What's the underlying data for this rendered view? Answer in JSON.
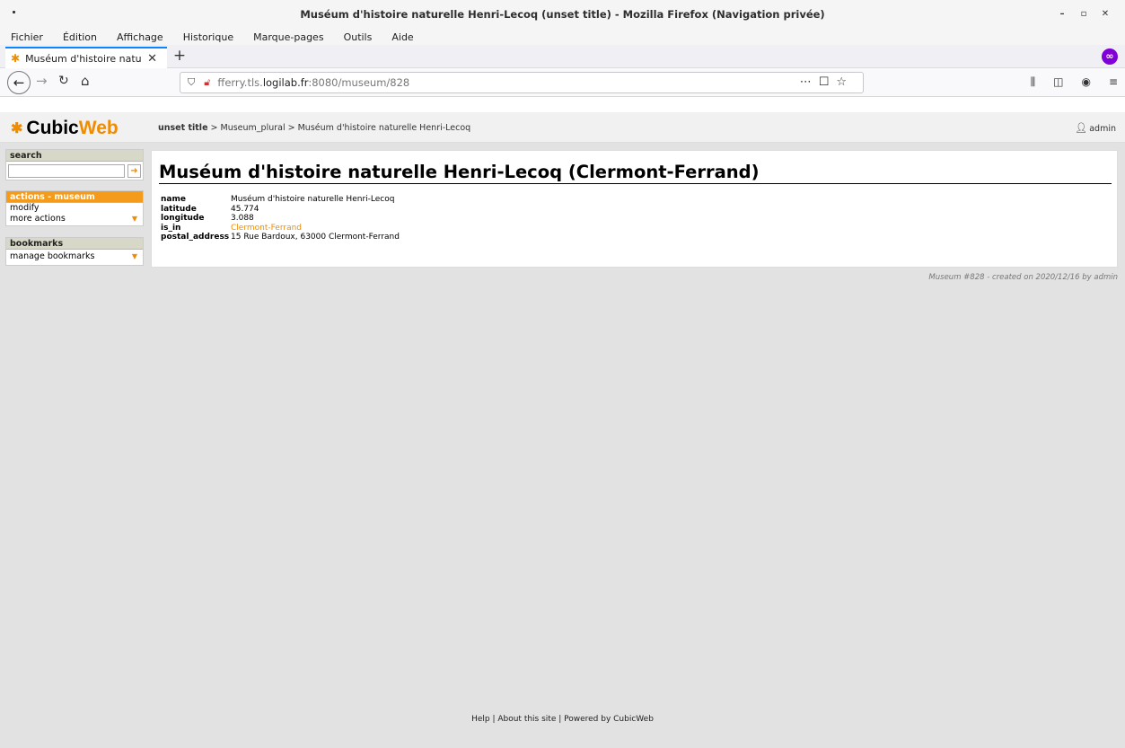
{
  "window": {
    "title": "Muséum d'histoire naturelle Henri-Lecoq (unset title) - Mozilla Firefox (Navigation privée)"
  },
  "menubar": {
    "items": [
      "Fichier",
      "Édition",
      "Affichage",
      "Historique",
      "Marque-pages",
      "Outils",
      "Aide"
    ]
  },
  "tab": {
    "title": "Muséum d'histoire naturelle",
    "close": "✕"
  },
  "urlbar": {
    "prefix": "fferry.tls.",
    "domain": "logilab.fr",
    "suffix": ":8080/museum/828"
  },
  "site": {
    "logo_cubic": "Cubic",
    "logo_web": "Web",
    "breadcrumb_root": "unset title",
    "breadcrumb_rest": " > Museum_plural > Muséum d'histoire naturelle Henri-Lecoq",
    "user": "admin"
  },
  "sidebar": {
    "search_title": "search",
    "actions_title": "actions - museum",
    "actions": [
      "modify",
      "more actions"
    ],
    "bookmarks_title": "bookmarks",
    "bookmarks": [
      "manage bookmarks"
    ]
  },
  "main": {
    "title": "Muséum d'histoire naturelle Henri-Lecoq (Clermont-Ferrand)",
    "attributes": [
      {
        "key": "name",
        "value": "Muséum d'histoire naturelle Henri-Lecoq"
      },
      {
        "key": "latitude",
        "value": "45.774"
      },
      {
        "key": "longitude",
        "value": "3.088"
      },
      {
        "key": "is_in",
        "value": "Clermont-Ferrand"
      },
      {
        "key": "postal_address",
        "value": "15 Rue Bardoux, 63000 Clermont-Ferrand"
      }
    ],
    "meta": "Museum #828 - created on 2020/12/16 by admin"
  },
  "footer": {
    "text": "Help | About this site | Powered by CubicWeb"
  },
  "colors": {
    "accent": "#f08c00",
    "firefox_blue": "#0a84ff",
    "private": "#8000d7"
  }
}
